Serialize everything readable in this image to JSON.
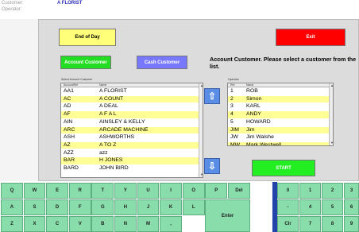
{
  "header": {
    "customer_label": "Customer:",
    "customer_value": "A FLORIST",
    "operator_label": "Operator:"
  },
  "buttons": {
    "end_of_day": "End of Day",
    "exit": "Exit",
    "account_customer": "Account Customer",
    "cash_customer": "Cash Customer",
    "start": "START"
  },
  "instruction": "Account Customer.  Please select a customer from the list.",
  "account_list": {
    "label": "Select Account Customer",
    "columns": [
      "AccountRef",
      "Name"
    ],
    "rows": [
      {
        "ref": "AA1",
        "name": "A FLORIST"
      },
      {
        "ref": "AC",
        "name": "A COUNT"
      },
      {
        "ref": "AD",
        "name": "A DEAL"
      },
      {
        "ref": "AF",
        "name": "A F A L"
      },
      {
        "ref": "AIN",
        "name": "AINSLEY & KELLY"
      },
      {
        "ref": "ARC",
        "name": "ARCADE MACHINE"
      },
      {
        "ref": "ASH",
        "name": "ASHWORTHS"
      },
      {
        "ref": "AZ",
        "name": "A TO Z"
      },
      {
        "ref": "AZZ",
        "name": "azz"
      },
      {
        "ref": "BAR",
        "name": "H JONES"
      },
      {
        "ref": "BARD",
        "name": "JOHN BIRD"
      }
    ]
  },
  "operator_list": {
    "label": "Operator",
    "columns": [
      "Ref",
      "Name"
    ],
    "rows": [
      {
        "ref": "1",
        "name": "ROB"
      },
      {
        "ref": "2",
        "name": "Simon"
      },
      {
        "ref": "3",
        "name": "KARL"
      },
      {
        "ref": "4",
        "name": "ANDY"
      },
      {
        "ref": "5",
        "name": "HOWARD"
      },
      {
        "ref": "JIM",
        "name": "Jim"
      },
      {
        "ref": "JW",
        "name": "Jim Walshe"
      },
      {
        "ref": "MW",
        "name": "Mark Westwell"
      }
    ]
  },
  "scroll_icons": {
    "up": "up-arrow-icon",
    "down": "down-arrow-icon"
  },
  "keyboard": {
    "row1": [
      "Q",
      "W",
      "E",
      "R",
      "T",
      "Y",
      "U",
      "I",
      "O",
      "P",
      "Del",
      "0",
      "1",
      "2",
      "3"
    ],
    "row2": [
      "A",
      "S",
      "D",
      "F",
      "G",
      "H",
      "J",
      "K",
      "L",
      "-",
      "4",
      "5",
      "6"
    ],
    "row3": [
      "Z",
      "X",
      "C",
      "V",
      "B",
      "N",
      "M",
      ",",
      "Clr",
      "7",
      "8",
      "9"
    ],
    "enter": "Enter"
  },
  "colors": {
    "accent_yellow": "#ffff7a",
    "exit_red": "#ff0000",
    "account_green": "#22dd22",
    "cash_blue": "#7878ff",
    "key_green": "#88ddaa",
    "row_highlight": "#ffff96"
  }
}
